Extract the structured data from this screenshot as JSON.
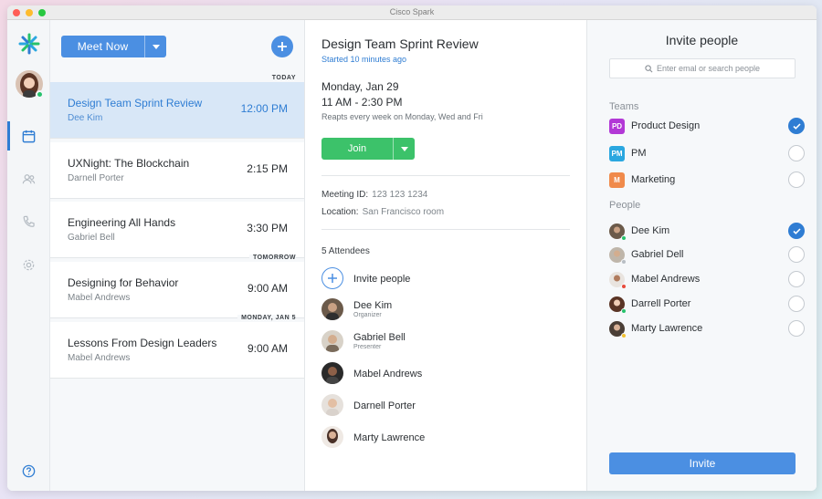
{
  "window": {
    "title": "Cisco Spark"
  },
  "rail": {
    "nav": [
      "calendar-icon",
      "people-icon",
      "phone-icon",
      "settings-icon"
    ],
    "help": "help-icon"
  },
  "list": {
    "meet_now_label": "Meet Now",
    "day_labels": {
      "today": "TODAY",
      "tomorrow": "TOMORROW",
      "monday": "MONDAY, JAN 5"
    },
    "meetings": [
      {
        "title": "Design Team Sprint Review",
        "host": "Dee Kim",
        "time": "12:00 PM"
      },
      {
        "title": "UXNight: The Blockchain",
        "host": "Darnell  Porter",
        "time": "2:15 PM"
      },
      {
        "title": "Engineering All Hands",
        "host": "Gabriel Bell",
        "time": "3:30 PM"
      },
      {
        "title": "Designing for Behavior",
        "host": "Mabel Andrews",
        "time": "9:00 AM"
      },
      {
        "title": "Lessons From Design Leaders",
        "host": "Mabel Andrews",
        "time": "9:00 AM"
      }
    ]
  },
  "detail": {
    "title": "Design Team Sprint Review",
    "started": "Started 10 minutes ago",
    "date": "Monday, Jan 29",
    "time": "11 AM - 2:30 PM",
    "repeat": "Reapts every week on Monday, Wed and Fri",
    "join_label": "Join",
    "meeting_id_label": "Meeting ID:",
    "meeting_id": "123 123 1234",
    "location_label": "Location:",
    "location": "San Francisco room",
    "attendees_count": "5 Attendees",
    "invite_label": "Invite people",
    "attendees": [
      {
        "name": "Dee Kim",
        "role": "Organizer"
      },
      {
        "name": "Gabriel Bell",
        "role": "Presenter"
      },
      {
        "name": "Mabel Andrews",
        "role": ""
      },
      {
        "name": "Darnell  Porter",
        "role": ""
      },
      {
        "name": "Marty Lawrence",
        "role": ""
      }
    ]
  },
  "invite": {
    "title": "Invite people",
    "search_placeholder": "Enter emal or search people",
    "teams_label": "Teams",
    "people_label": "People",
    "teams": [
      {
        "badge": "PD",
        "name": "Product Design",
        "color": "#b238d6",
        "checked": true
      },
      {
        "badge": "PM",
        "name": "PM",
        "color": "#2aa7e0",
        "checked": false
      },
      {
        "badge": "M",
        "name": "Marketing",
        "color": "#f08a4b",
        "checked": false
      }
    ],
    "people": [
      {
        "name": "Dee Kim",
        "status": "#27c26c",
        "checked": true
      },
      {
        "name": "Gabriel Dell",
        "status": "#b8bec4",
        "checked": false
      },
      {
        "name": "Mabel Andrews",
        "status": "#e84b3c",
        "checked": false
      },
      {
        "name": "Darrell  Porter",
        "status": "#27c26c",
        "checked": false
      },
      {
        "name": "Marty Lawrence",
        "status": "#f2c130",
        "checked": false
      }
    ],
    "invite_button": "Invite"
  },
  "colors": {
    "accent": "#4b8fe2",
    "join": "#3cc26a",
    "selected_row": "#d8e7f7"
  }
}
